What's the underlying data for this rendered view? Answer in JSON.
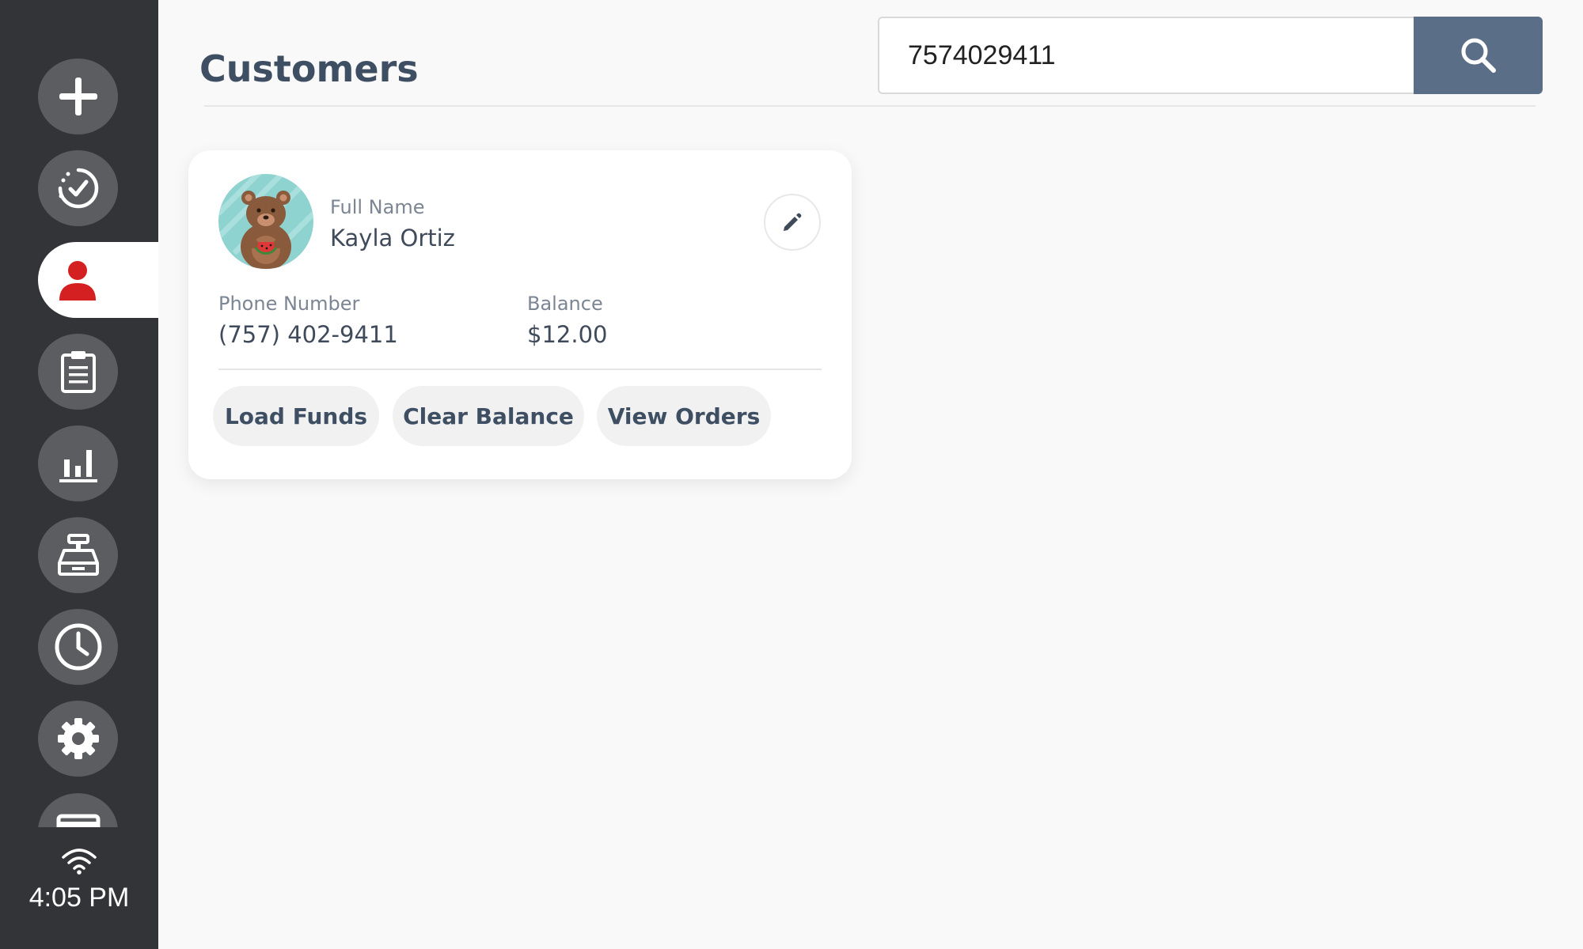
{
  "sidebar": {
    "items": [
      {
        "icon": "plus-icon"
      },
      {
        "icon": "check-circle-icon"
      },
      {
        "icon": "user-icon",
        "active": true
      },
      {
        "icon": "clipboard-icon"
      },
      {
        "icon": "bar-chart-icon"
      },
      {
        "icon": "cash-register-icon"
      },
      {
        "icon": "clock-icon"
      },
      {
        "icon": "gear-icon"
      },
      {
        "icon": "card-icon"
      }
    ],
    "status": {
      "wifi_icon": "wifi-icon",
      "time": "4:05 PM"
    }
  },
  "header": {
    "title": "Customers"
  },
  "search": {
    "value": "7574029411",
    "button_icon": "search-icon"
  },
  "customer_card": {
    "avatar_icon": "bear-avatar",
    "full_name_label": "Full Name",
    "full_name": "Kayla Ortiz",
    "phone_label": "Phone Number",
    "phone": "(757) 402-9411",
    "balance_label": "Balance",
    "balance": "$12.00",
    "edit_icon": "pencil-icon",
    "actions": {
      "load_funds": "Load Funds",
      "clear_balance": "Clear Balance",
      "view_orders": "View Orders"
    }
  },
  "colors": {
    "sidebar_bg": "#333437",
    "nav_button_bg": "#5c5d61",
    "active_icon": "#d42020",
    "search_button_bg": "#5a6e88",
    "title_color": "#3f4f63"
  }
}
